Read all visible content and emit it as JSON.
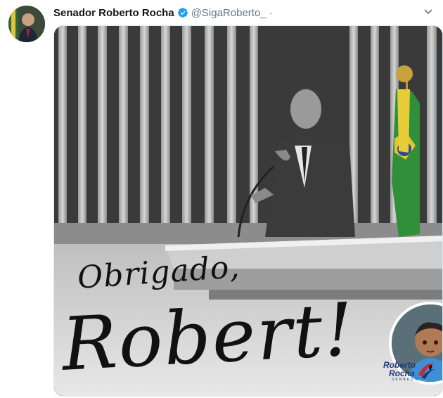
{
  "tweet": {
    "display_name": "Senador Roberto Rocha",
    "handle": "@SigaRoberto_",
    "separator": "·"
  },
  "image_text": {
    "line1": "Obrigado,",
    "line2": "Robert!"
  },
  "logo": {
    "line1": "Roberto",
    "line2": "Rocha",
    "line3": "SENADOR"
  },
  "colors": {
    "verified": "#1da1f2",
    "handle": "#657786",
    "logo_blue": "#1f3a78",
    "logo_red": "#d0232b"
  },
  "icons": {
    "verified": "verified-badge-icon",
    "caret": "chevron-down-icon"
  }
}
